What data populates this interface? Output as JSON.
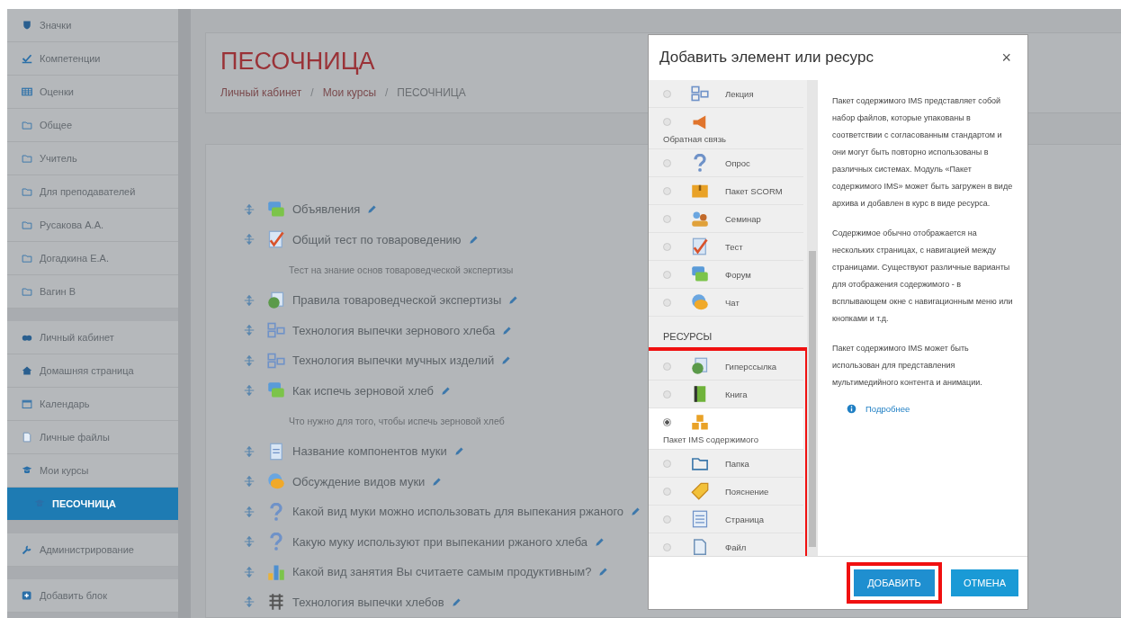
{
  "sidebar": {
    "groups": [
      {
        "items": [
          {
            "label": "Значки",
            "kind": "badge",
            "selected": false
          },
          {
            "label": "Компетенции",
            "kind": "check",
            "selected": false
          },
          {
            "label": "Оценки",
            "kind": "grades",
            "selected": false
          },
          {
            "label": "Общее",
            "kind": "folder",
            "selected": false
          },
          {
            "label": "Учитель",
            "kind": "folder",
            "selected": false
          },
          {
            "label": "Для преподавателей",
            "kind": "folder",
            "selected": false
          },
          {
            "label": "Русакова А.А.",
            "kind": "folder",
            "selected": false
          },
          {
            "label": "Догадкина Е.А.",
            "kind": "folder",
            "selected": false
          },
          {
            "label": "Вагин В",
            "kind": "folder",
            "selected": false
          }
        ]
      },
      {
        "items": [
          {
            "label": "Личный кабинет",
            "kind": "dashboard",
            "selected": false
          },
          {
            "label": "Домашняя страница",
            "kind": "home",
            "selected": false
          },
          {
            "label": "Календарь",
            "kind": "calendar",
            "selected": false
          },
          {
            "label": "Личные файлы",
            "kind": "file",
            "selected": false
          },
          {
            "label": "Мои курсы",
            "kind": "cap",
            "selected": false,
            "children": [
              {
                "label": "ПЕСОЧНИЦА",
                "kind": "cap",
                "selected": true
              }
            ]
          }
        ]
      },
      {
        "items": [
          {
            "label": "Администрирование",
            "kind": "wrench",
            "selected": false
          }
        ]
      },
      {
        "items": [
          {
            "label": "Добавить блок",
            "kind": "plus",
            "selected": false
          }
        ]
      }
    ]
  },
  "header": {
    "title": "ПЕСОЧНИЦА",
    "breadcrumb": [
      "Личный кабинет",
      "Мои курсы",
      "ПЕСОЧНИЦА"
    ],
    "separator": "/"
  },
  "course_items": [
    {
      "title": "Объявления",
      "kind": "forum"
    },
    {
      "title": "Общий тест по товароведению",
      "kind": "quiz",
      "description": "Тест на знание основ товароведческой экспертизы"
    },
    {
      "title": "Правила товароведческой экспертизы",
      "kind": "url"
    },
    {
      "title": "Технология выпечки зернового хлеба",
      "kind": "lesson"
    },
    {
      "title": "Технология выпечки мучных изделий",
      "kind": "lesson"
    },
    {
      "title": "Как испечь зерновой хлеб",
      "kind": "forum",
      "description": "Что нужно для того, чтобы испечь зерновой хлеб"
    },
    {
      "title": "Название компонентов муки",
      "kind": "glossary"
    },
    {
      "title": "Обсуждение видов муки",
      "kind": "chat"
    },
    {
      "title": "Какой вид муки можно использовать для выпекания ржаного",
      "kind": "question"
    },
    {
      "title": "Какую муку используют при выпекании ржаного хлеба",
      "kind": "question"
    },
    {
      "title": "Какой вид занятия Вы считаете самым продуктивным?",
      "kind": "choice"
    },
    {
      "title": "Технология выпечки хлебов",
      "kind": "workshop"
    }
  ],
  "dialog": {
    "title": "Добавить элемент или ресурс",
    "close": "×",
    "activities": [
      {
        "label": "Лекция",
        "kind": "lesson",
        "selected": false,
        "label_below": false
      },
      {
        "label": "Обратная связь",
        "kind": "feedback",
        "selected": false,
        "label_below": true
      },
      {
        "label": "Опрос",
        "kind": "question",
        "selected": false,
        "label_below": false
      },
      {
        "label": "Пакет SCORM",
        "kind": "scorm",
        "selected": false,
        "label_below": false
      },
      {
        "label": "Семинар",
        "kind": "seminar",
        "selected": false,
        "label_below": false
      },
      {
        "label": "Тест",
        "kind": "quiz",
        "selected": false,
        "label_below": false
      },
      {
        "label": "Форум",
        "kind": "forum",
        "selected": false,
        "label_below": false
      },
      {
        "label": "Чат",
        "kind": "chat",
        "selected": false,
        "label_below": false
      }
    ],
    "resources": {
      "heading": "РЕСУРСЫ",
      "highlighted": true,
      "items": [
        {
          "label": "Гиперссылка",
          "kind": "url",
          "selected": false,
          "label_below": false
        },
        {
          "label": "Книга",
          "kind": "book",
          "selected": false,
          "label_below": false
        },
        {
          "label": "Пакет IMS содержимого",
          "kind": "ims",
          "selected": true,
          "label_below": true
        },
        {
          "label": "Папка",
          "kind": "folder",
          "selected": false,
          "label_below": false
        },
        {
          "label": "Пояснение",
          "kind": "label",
          "selected": false,
          "label_below": false
        },
        {
          "label": "Страница",
          "kind": "page",
          "selected": false,
          "label_below": false
        },
        {
          "label": "Файл",
          "kind": "file",
          "selected": false,
          "label_below": false
        }
      ]
    },
    "description": [
      "Пакет содержимого IMS представляет собой набор файлов, которые упакованы в соответствии с согласованным стандартом и они могут быть повторно использованы в различных системах. Модуль «Пакет содержимого IMS» может быть загружен в виде архива и добавлен в курс в виде ресурса.",
      "Содержимое обычно отображается на нескольких страницах, с навигацией между страницами. Существуют различные варианты для отображения содержимого - в всплывающем окне с навигационным меню или кнопками и т.д.",
      "Пакет содержимого IMS может быть использован для представления мультимедийного контента и анимации."
    ],
    "more_link": "Подробнее",
    "buttons": [
      {
        "label": "ДОБАВИТЬ",
        "kind": "primary",
        "highlighted": true
      },
      {
        "label": "ОТМЕНА",
        "kind": "secondary",
        "highlighted": false
      }
    ]
  }
}
